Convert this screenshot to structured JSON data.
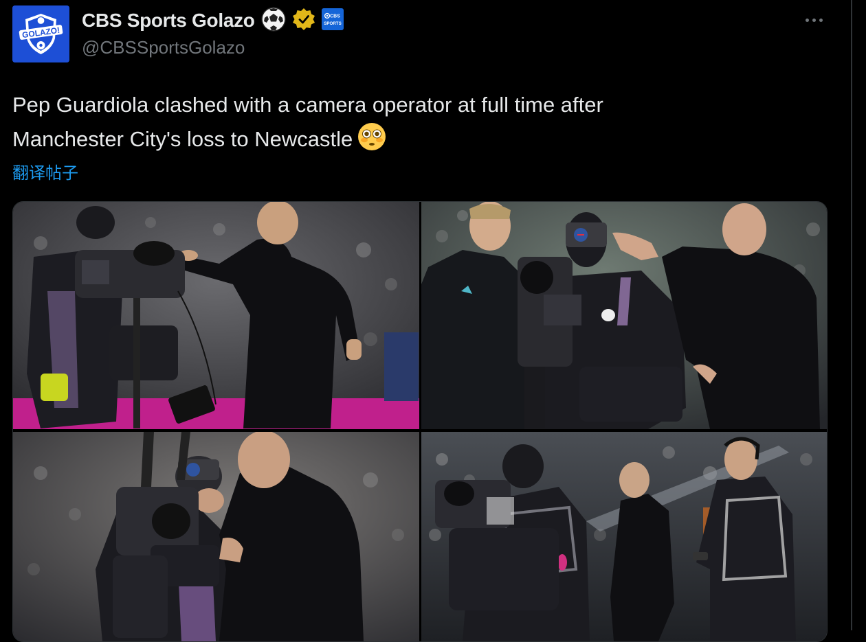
{
  "author": {
    "display_name": "CBS Sports Golazo",
    "handle": "@CBSSportsGolazo",
    "avatar_text": "GOLAZO!",
    "badges": [
      "soccer-ball-emoji",
      "gold-verified-check",
      "cbs-sports-affiliate"
    ],
    "affiliate_badge_text": "CBS SPORTS"
  },
  "post": {
    "text_line1": "Pep Guardiola clashed with a camera operator at full time after",
    "text_line2": "Manchester City's loss to Newcastle",
    "text_emoji": "flushed-face-emoji",
    "translate_label": "翻译帖子"
  },
  "media": {
    "count": 4,
    "photos": [
      {
        "id": "photo-1",
        "subject": "manager-pushing-camera"
      },
      {
        "id": "photo-2",
        "subject": "hand-on-cameraman-headset"
      },
      {
        "id": "photo-3",
        "subject": "manager-leaning-into-camera"
      },
      {
        "id": "photo-4",
        "subject": "manager-standing-pitchside"
      }
    ]
  },
  "colors": {
    "background": "#000000",
    "text_primary": "#e7e9ea",
    "text_secondary": "#71767b",
    "link": "#1d9bf0",
    "verified_gold": "#e2b719",
    "avatar_blue": "#1d4fd6"
  }
}
